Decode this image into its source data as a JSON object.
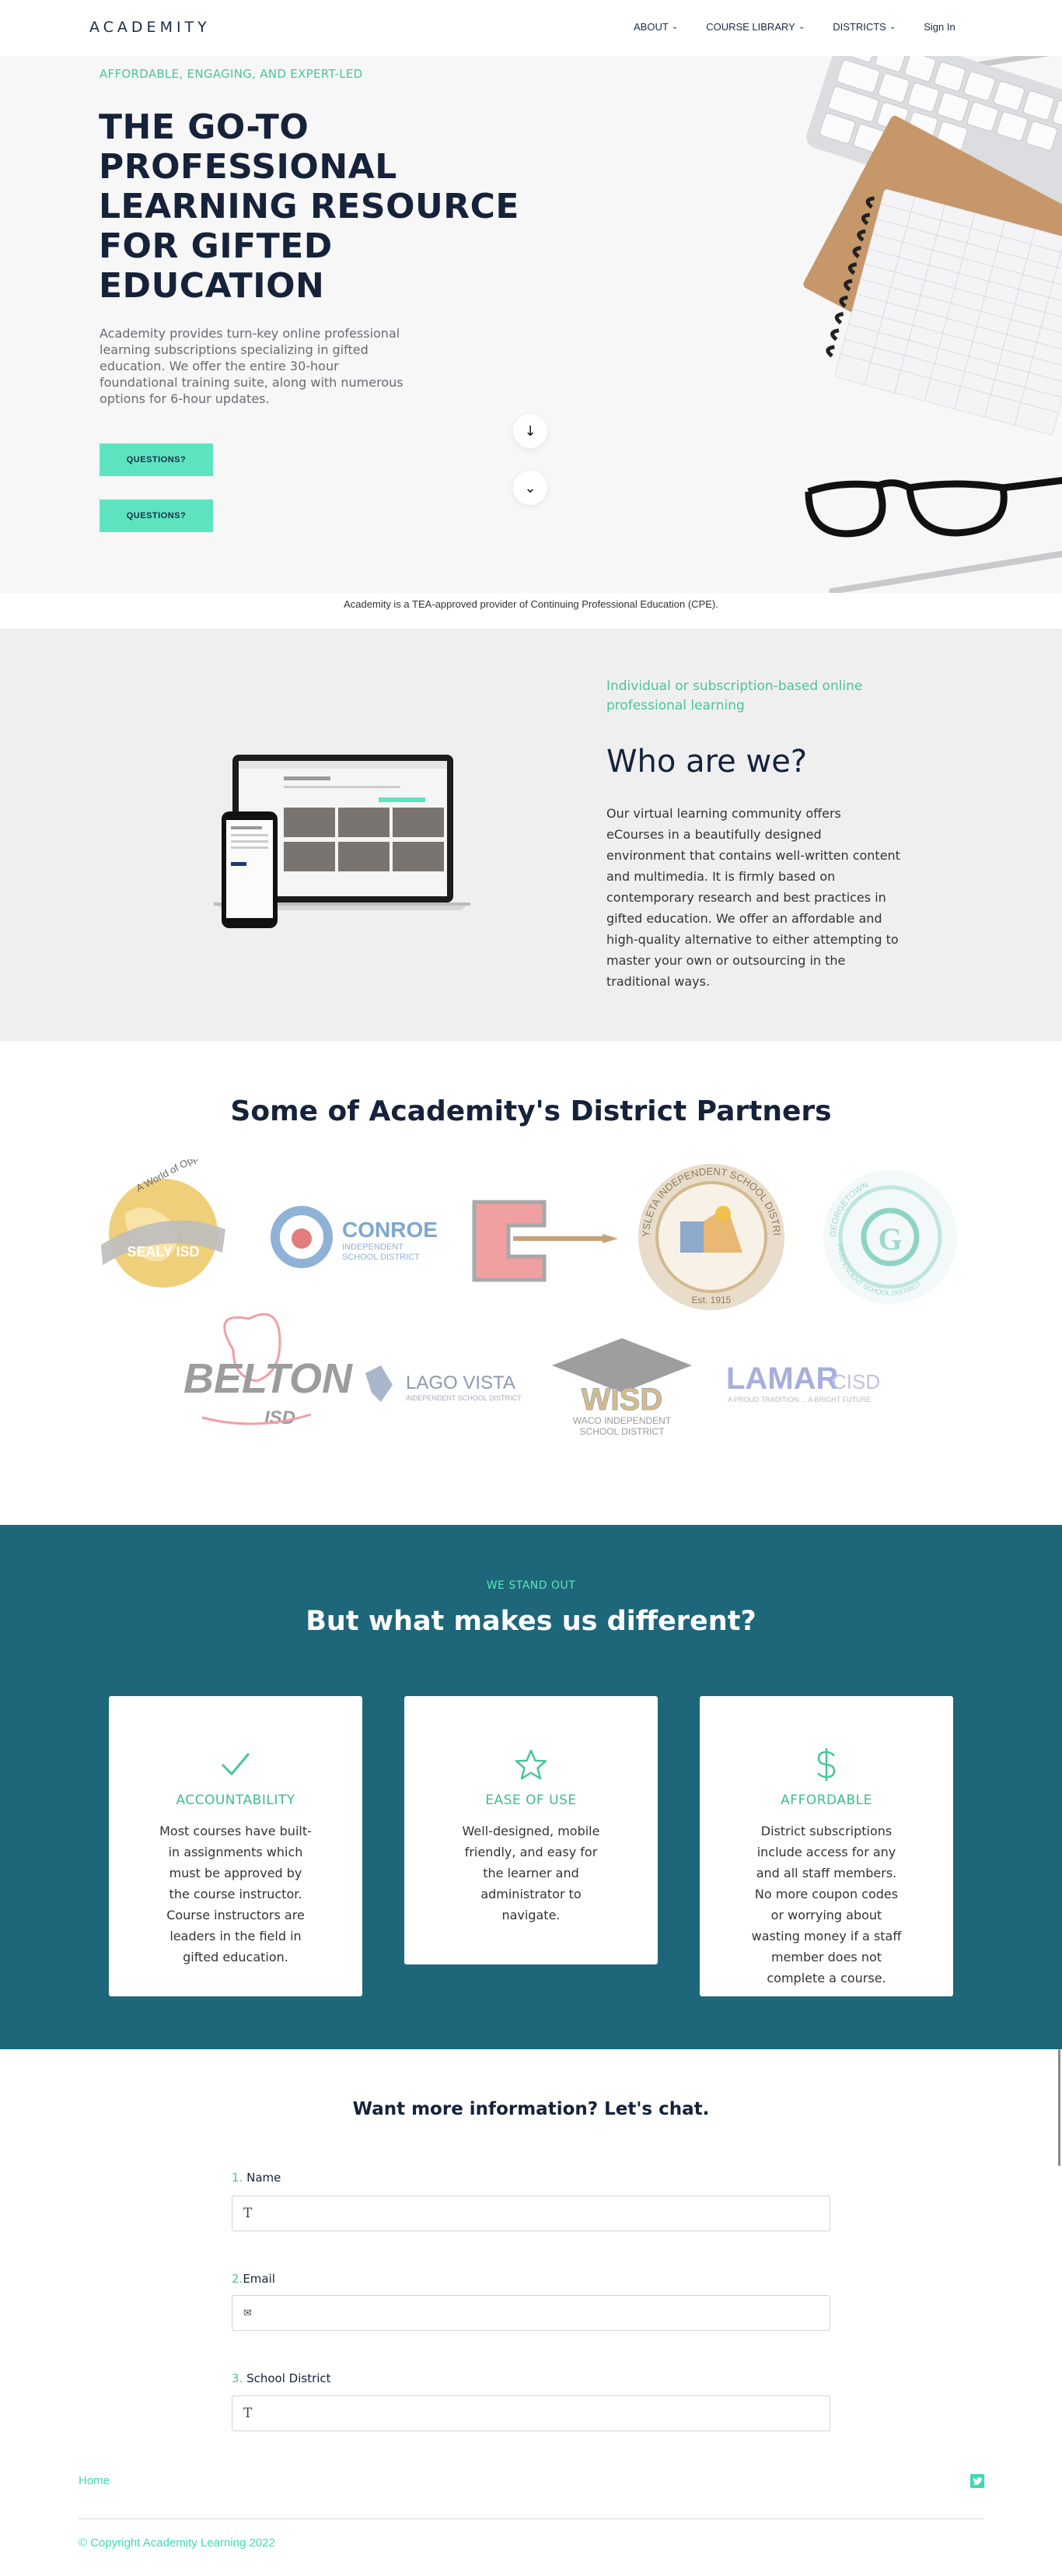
{
  "nav": {
    "logo": "ACADEMITY",
    "items": [
      {
        "label": "ABOUT",
        "has_menu": true
      },
      {
        "label": "COURSE LIBRARY",
        "has_menu": true
      },
      {
        "label": "DISTRICTS",
        "has_menu": true
      }
    ],
    "signin": "Sign In"
  },
  "hero": {
    "eyebrow": "AFFORDABLE, ENGAGING, AND EXPERT-LED",
    "title": "THE GO-TO PROFESSIONAL LEARNING RESOURCE FOR GIFTED EDUCATION",
    "description": "Academity provides turn-key online professional learning subscriptions specializing in gifted education. We offer the entire 30-hour foundational training suite, along with numerous options for 6-hour updates.",
    "cta_primary": "QUESTIONS?",
    "cta_secondary": "QUESTIONS?",
    "scroll_icon": "arrow-down-icon"
  },
  "cpe_notice": "Academity is a TEA-approved provider of Continuing Professional Education (CPE).",
  "who": {
    "eyebrow": "Individual or subscription-based online professional learning",
    "title": "Who are we?",
    "body": "Our virtual learning community offers eCourses in a beautifully designed environment that contains well-written content and multimedia. It is firmly based on contemporary research and best practices in gifted education. We offer an affordable and high-quality alternative to either attempting to master your own or outsourcing in the traditional ways."
  },
  "partners": {
    "title": "Some of Academity's District Partners",
    "logos": {
      "sealy_arc": "A World of Opportunities",
      "sealy": "SEALY ISD",
      "conroe": "CONROE",
      "conroe_sub1": "INDEPENDENT",
      "conroe_sub2": "SCHOOL DISTRICT",
      "ysleta_ring": "YSLETA INDEPENDENT SCHOOL DISTRICT",
      "ysleta_est": "Est. 1915",
      "georgetown_top": "GEORGETOWN",
      "georgetown_bottom": "INDEPENDENT SCHOOL DISTRICT",
      "belton": "BELTON",
      "belton_isd": "ISD",
      "lago_vista": "LAGO VISTA",
      "lago_vista_sub": "INDEPENDENT SCHOOL DISTRICT",
      "wisd": "WISD",
      "wisd_sub1": "WACO INDEPENDENT",
      "wisd_sub2": "SCHOOL DISTRICT",
      "lamar": "LAMAR",
      "lamar_cisd": "CISD",
      "lamar_sub": "A PROUD TRADITION ... A BRIGHT FUTURE"
    }
  },
  "different": {
    "eyebrow": "WE STAND OUT",
    "title": "But what makes us different?",
    "cards": [
      {
        "icon": "checkmark-icon",
        "title": "ACCOUNTABILITY",
        "body": "Most courses have built-in assignments which must be approved by the course instructor. Course instructors are leaders in the field in gifted education."
      },
      {
        "icon": "star-icon",
        "title": "EASE OF USE",
        "body": "Well-designed, mobile friendly, and easy for the learner and administrator to navigate."
      },
      {
        "icon": "dollar-icon",
        "title": "AFFORDABLE",
        "body": "District subscriptions include access for any and all staff members. No more coupon codes or worrying about wasting money if a staff member does not complete a course."
      }
    ]
  },
  "form": {
    "title": "Want more information? Let's chat.",
    "fields": [
      {
        "num": "1.",
        "label": "Name",
        "icon": "text-icon",
        "glyph": "T"
      },
      {
        "num": "2.",
        "label": "Email",
        "icon": "envelope-icon",
        "glyph": "✉"
      },
      {
        "num": "3.",
        "label": "School District",
        "icon": "text-icon",
        "glyph": "T"
      }
    ]
  },
  "footer": {
    "home": "Home",
    "copyright": "© Copyright Academity Learning 2022",
    "social_icon": "twitter-icon"
  },
  "colors": {
    "accent": "#5ee3c1",
    "green_text": "#49c59a",
    "navy": "#15223a",
    "teal_band": "#1e6679"
  }
}
